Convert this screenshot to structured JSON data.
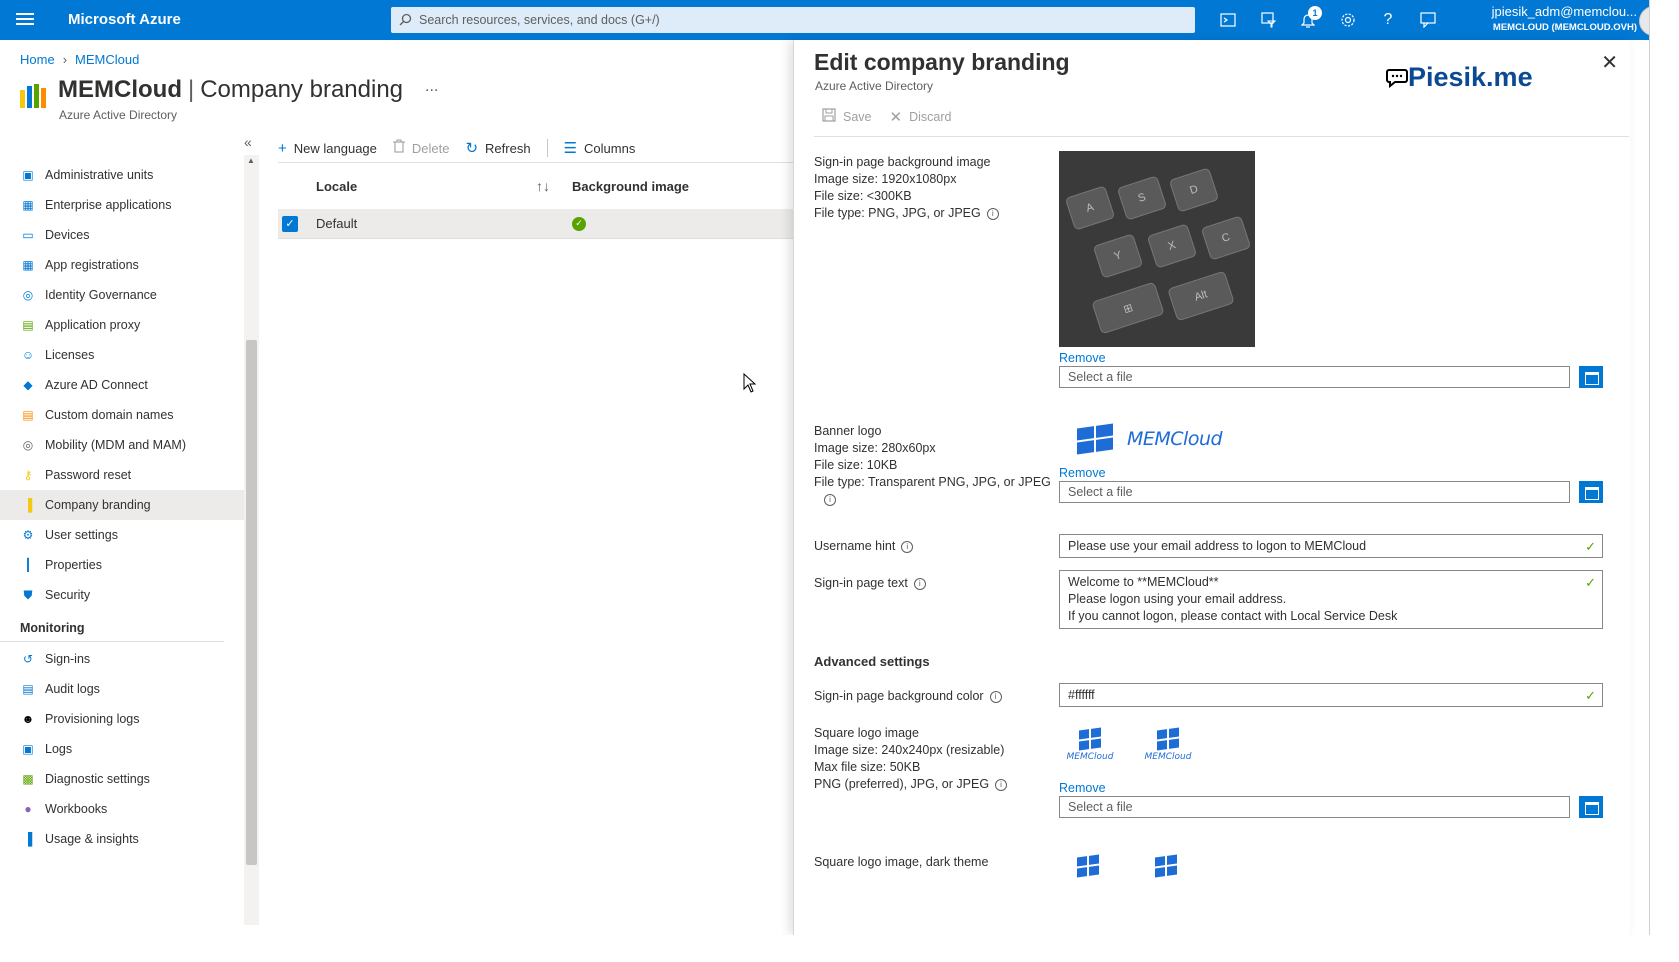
{
  "topbar": {
    "brand": "Microsoft Azure",
    "search_placeholder": "Search resources, services, and docs (G+/)",
    "notification_count": "1",
    "icons": [
      "cloud-shell-icon",
      "directory-filter-icon",
      "notifications-icon",
      "settings-icon",
      "help-icon",
      "feedback-icon"
    ],
    "account_name": "jpiesik_adm@memclou...",
    "account_tenant": "MEMCLOUD (MEMCLOUD.OVH)"
  },
  "breadcrumb": {
    "home": "Home",
    "current": "MEMCloud"
  },
  "header": {
    "title": "MEMCloud",
    "section": "Company branding",
    "subtitle": "Azure Active Directory",
    "more": "..."
  },
  "sidebar": {
    "items": [
      {
        "label": "Administrative units",
        "icon": "admin-units-icon"
      },
      {
        "label": "Enterprise applications",
        "icon": "enterprise-apps-icon"
      },
      {
        "label": "Devices",
        "icon": "devices-icon"
      },
      {
        "label": "App registrations",
        "icon": "app-registrations-icon"
      },
      {
        "label": "Identity Governance",
        "icon": "identity-governance-icon"
      },
      {
        "label": "Application proxy",
        "icon": "application-proxy-icon"
      },
      {
        "label": "Licenses",
        "icon": "licenses-icon"
      },
      {
        "label": "Azure AD Connect",
        "icon": "azure-ad-connect-icon"
      },
      {
        "label": "Custom domain names",
        "icon": "custom-domain-icon"
      },
      {
        "label": "Mobility (MDM and MAM)",
        "icon": "mobility-icon"
      },
      {
        "label": "Password reset",
        "icon": "password-reset-icon"
      },
      {
        "label": "Company branding",
        "icon": "company-branding-icon",
        "active": true
      },
      {
        "label": "User settings",
        "icon": "user-settings-icon"
      },
      {
        "label": "Properties",
        "icon": "properties-icon"
      },
      {
        "label": "Security",
        "icon": "security-icon"
      }
    ],
    "monitoring_heading": "Monitoring",
    "monitoring_items": [
      {
        "label": "Sign-ins",
        "icon": "sign-ins-icon"
      },
      {
        "label": "Audit logs",
        "icon": "audit-logs-icon"
      },
      {
        "label": "Provisioning logs",
        "icon": "provisioning-logs-icon"
      },
      {
        "label": "Logs",
        "icon": "logs-icon"
      },
      {
        "label": "Diagnostic settings",
        "icon": "diagnostic-settings-icon"
      },
      {
        "label": "Workbooks",
        "icon": "workbooks-icon"
      },
      {
        "label": "Usage & insights",
        "icon": "usage-insights-icon"
      }
    ]
  },
  "commands": {
    "new_language": "New language",
    "delete": "Delete",
    "refresh": "Refresh",
    "columns": "Columns"
  },
  "grid": {
    "columns": [
      "Locale",
      "Background image"
    ],
    "rows": [
      {
        "locale": "Default",
        "background_image": "configured",
        "selected": true
      }
    ]
  },
  "blade": {
    "title": "Edit company branding",
    "subtitle": "Azure Active Directory",
    "watermark": "Piesik.me",
    "save": "Save",
    "discard": "Discard",
    "bg_image": {
      "label": "Sign-in page background image",
      "size": "Image size: 1920x1080px",
      "filesize": "File size: <300KB",
      "filetype": "File type: PNG, JPG, or JPEG",
      "keys": [
        "A",
        "S",
        "D",
        "Y",
        "X",
        "C",
        "Alt"
      ]
    },
    "banner": {
      "label": "Banner logo",
      "size": "Image size: 280x60px",
      "filesize": "File size: 10KB",
      "filetype": "File type: Transparent PNG, JPG, or JPEG",
      "logo_text": "MEMCloud"
    },
    "username_hint": {
      "label": "Username hint",
      "value": "Please use your email address to logon to MEMCloud"
    },
    "signin_text": {
      "label": "Sign-in page text",
      "line1": "Welcome to **MEMCloud**",
      "line2": "Please logon using your email address.",
      "line3": "If you cannot logon, please contact with Local Service Desk"
    },
    "advanced_heading": "Advanced settings",
    "bg_color": {
      "label": "Sign-in page background color",
      "value": "#ffffff"
    },
    "square_logo": {
      "label": "Square logo image",
      "size": "Image size: 240x240px (resizable)",
      "filesize": "Max file size: 50KB",
      "filetype": "PNG (preferred), JPG, or JPEG",
      "logo_text": "MEMCloud"
    },
    "square_dark_label": "Square logo image, dark theme",
    "remove": "Remove",
    "select_file": "Select a file"
  }
}
